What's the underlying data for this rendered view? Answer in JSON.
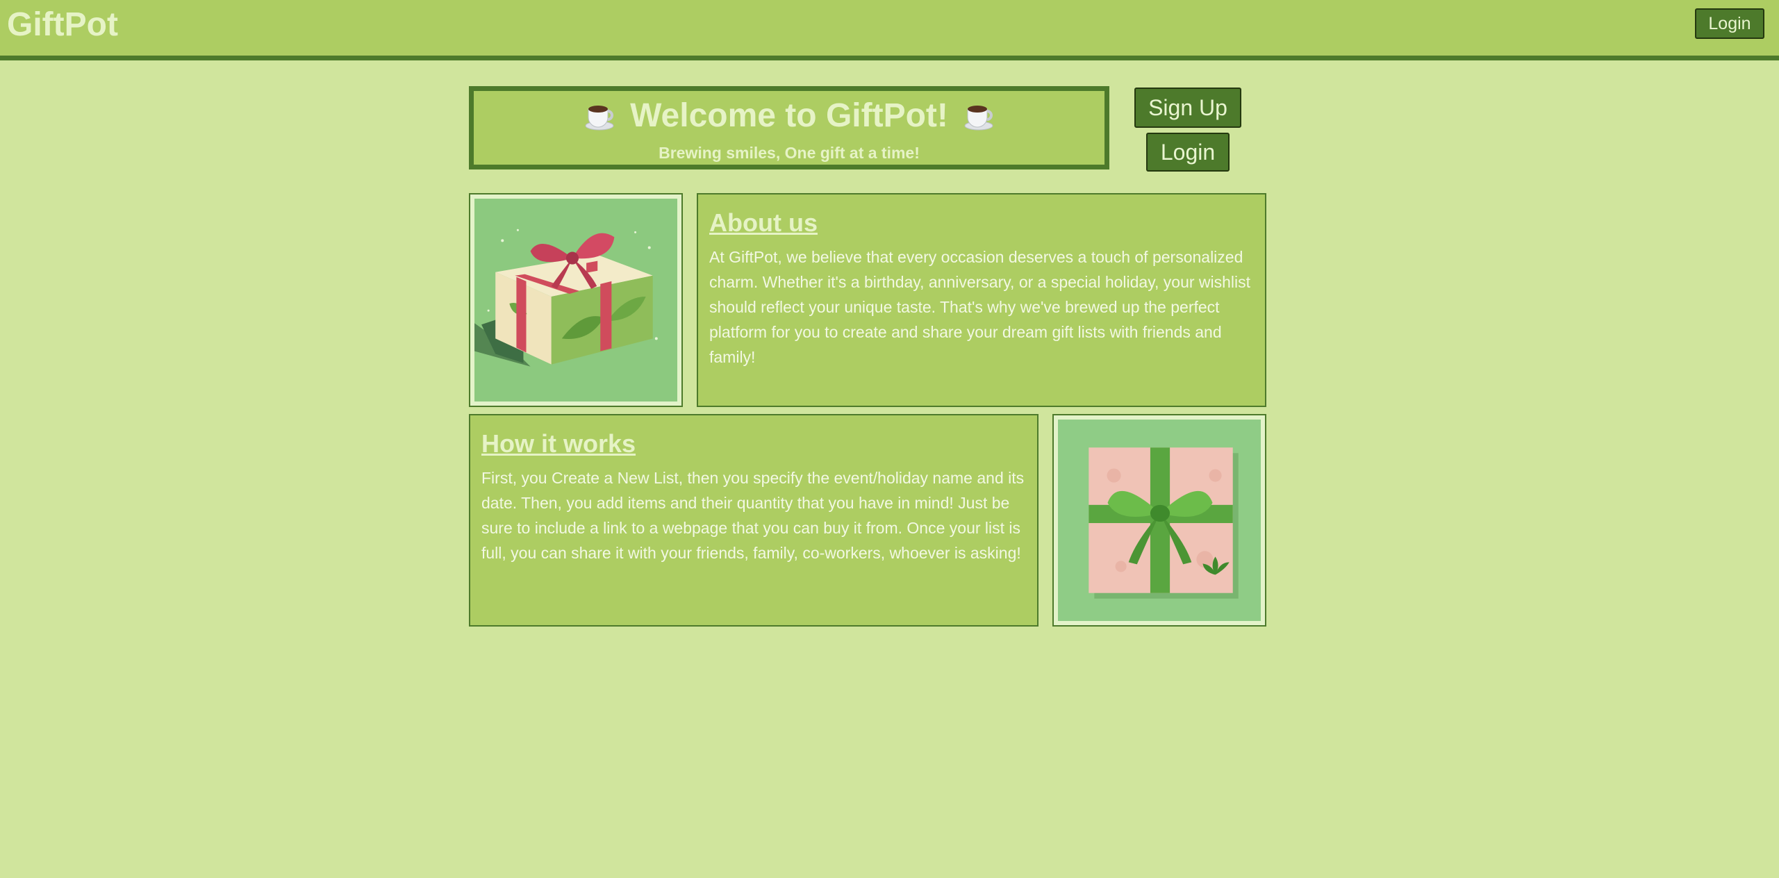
{
  "nav": {
    "brand": "GiftPot",
    "login_label": "Login"
  },
  "hero": {
    "title": "Welcome to GiftPot!",
    "subtitle": "Brewing smiles, One gift at a time!",
    "icon": "coffee-cup-icon"
  },
  "actions": {
    "signup_label": "Sign Up",
    "login_label": "Login"
  },
  "about": {
    "heading": "About us",
    "body": "At GiftPot, we believe that every occasion deserves a touch of personalized charm. Whether it's a birthday, anniversary, or a special holiday, your wishlist should reflect your unique taste. That's why we've brewed up the perfect platform for you to create and share your dream gift lists with friends and family!"
  },
  "how": {
    "heading": "How it works",
    "body": "First, you Create a New List, then you specify the event/holiday name and its date. Then, you add items and their quantity that you have in mind! Just be sure to include a link to a webpage that you can buy it from. Once your list is full, you can share it with your friends, family, co-workers, whoever is asking!"
  },
  "colors": {
    "page_bg": "#d0e59d",
    "panel": "#adcd62",
    "dark_green": "#4d7a2b",
    "text_light": "#e6f3c6"
  }
}
